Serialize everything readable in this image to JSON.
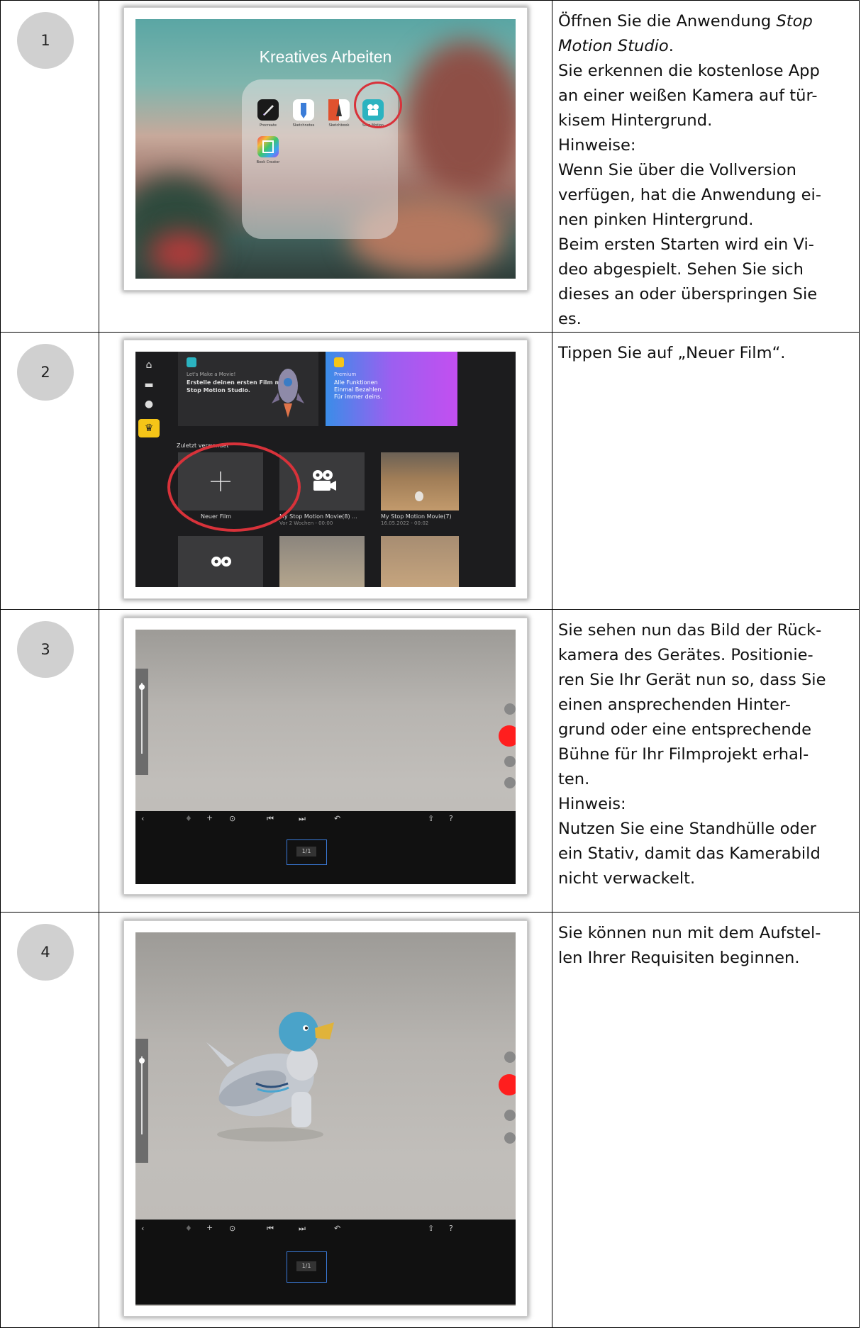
{
  "steps": [
    {
      "number": "1",
      "text_lines": [
        "Öffnen Sie die Anwendung ",
        "Motion Studio",
        "Sie erkennen die kostenlose App",
        "an einer weißen Kamera auf tür-",
        "kisem Hintergrund.",
        "Hinweise:",
        "Wenn Sie über die Vollversion",
        "verfügen, hat die Anwendung ei-",
        "nen pinken Hintergrund.",
        "Beim ersten Starten wird ein Vi-",
        "deo abgespielt. Sehen Sie sich",
        "dieses an oder überspringen Sie",
        "es."
      ],
      "italic_1": "Stop",
      "punct_2": ".",
      "screenshot": {
        "folder_title": "Kreatives Arbeiten",
        "apps": [
          "Procreate",
          "Sketchnotes",
          "Sketchbook",
          "Stop Motion",
          "Book Creator"
        ]
      }
    },
    {
      "number": "2",
      "text_lines": [
        "Tippen Sie auf „Neuer Film“."
      ],
      "screenshot": {
        "promo_kicker": "Let's Make a Movie!",
        "promo_line1": "Erstelle deinen ersten Film mit",
        "promo_line2": "Stop Motion Studio.",
        "premium_kicker": "Premium",
        "premium_line1": "Alle Funktionen",
        "premium_line2": "Einmal Bezahlen",
        "premium_line3": "Für immer deins.",
        "section": "Zuletzt verwendet",
        "new_film": "Neuer Film",
        "movie1_title": "My Stop Motion Movie(8) ...",
        "movie1_date": "Vor 2 Wochen - 00:00",
        "movie2_title": "My Stop Motion Movie(7)",
        "movie2_date": "16.05.2022 - 00:02"
      }
    },
    {
      "number": "3",
      "text_lines": [
        "Sie sehen nun das Bild der Rück-",
        "kamera des Gerätes. Positionie-",
        "ren Sie Ihr Gerät nun so, dass Sie",
        "einen ansprechenden Hinter-",
        "grund oder eine entsprechende",
        "Bühne für Ihr Filmprojekt erhal-",
        "ten.",
        "Hinweis:",
        "Nutzen Sie eine Standhülle oder",
        "ein Stativ, damit das Kamerabild",
        "nicht verwackelt."
      ],
      "screenshot": {
        "frame_counter": "1/1"
      }
    },
    {
      "number": "4",
      "text_lines": [
        "Sie können nun mit dem Aufstel-",
        "len Ihrer Requisiten beginnen."
      ],
      "screenshot": {
        "frame_counter": "1/1"
      }
    }
  ],
  "colors": {
    "record": "#ff1e1e",
    "promo_teal": "#2bb3c0",
    "premium_start": "#3a8de8",
    "premium_end": "#c34ff0",
    "highlight_ring": "#d8323a"
  }
}
